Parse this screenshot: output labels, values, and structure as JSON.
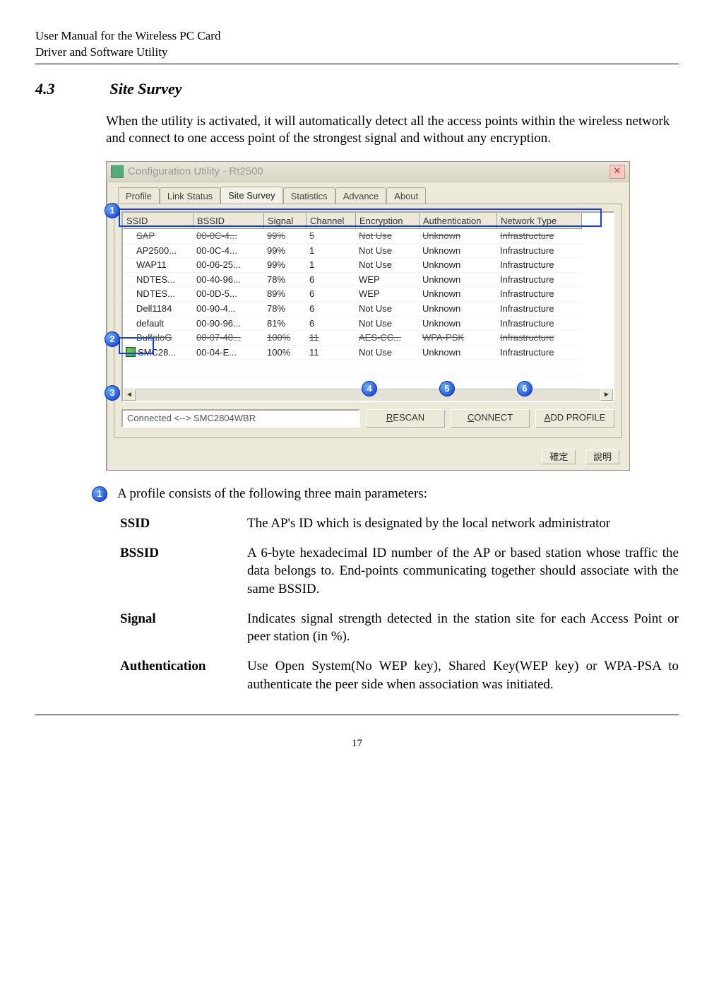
{
  "header": {
    "line1": "User Manual for the Wireless PC Card",
    "line2": "Driver and Software Utility"
  },
  "section": {
    "num": "4.3",
    "title": "Site Survey",
    "intro": "When the utility is activated, it will automatically detect all the access points within the wireless network and connect to one access point of the strongest signal and without any encryption."
  },
  "dialog": {
    "title": "Configuration Utility - Rt2500",
    "tabs": [
      "Profile",
      "Link Status",
      "Site Survey",
      "Statistics",
      "Advance",
      "About"
    ],
    "active_tab": 2,
    "columns": [
      "SSID",
      "BSSID",
      "Signal",
      "Channel",
      "Encryption",
      "Authentication",
      "Network Type"
    ],
    "rows": [
      {
        "ssid": "SAP",
        "bssid": "00-0C-4...",
        "signal": "99%",
        "channel": "5",
        "enc": "Not Use",
        "auth": "Unknown",
        "type": "Infrastructure",
        "strike": true
      },
      {
        "ssid": "AP2500...",
        "bssid": "00-0C-4...",
        "signal": "99%",
        "channel": "1",
        "enc": "Not Use",
        "auth": "Unknown",
        "type": "Infrastructure"
      },
      {
        "ssid": "WAP11",
        "bssid": "00-06-25...",
        "signal": "99%",
        "channel": "1",
        "enc": "Not Use",
        "auth": "Unknown",
        "type": "Infrastructure"
      },
      {
        "ssid": "NDTES...",
        "bssid": "00-40-96...",
        "signal": "78%",
        "channel": "6",
        "enc": "WEP",
        "auth": "Unknown",
        "type": "Infrastructure"
      },
      {
        "ssid": "NDTES...",
        "bssid": "00-0D-5...",
        "signal": "89%",
        "channel": "6",
        "enc": "WEP",
        "auth": "Unknown",
        "type": "Infrastructure"
      },
      {
        "ssid": "Dell1184",
        "bssid": "00-90-4...",
        "signal": "78%",
        "channel": "6",
        "enc": "Not Use",
        "auth": "Unknown",
        "type": "Infrastructure"
      },
      {
        "ssid": "default",
        "bssid": "00-90-96...",
        "signal": "81%",
        "channel": "6",
        "enc": "Not Use",
        "auth": "Unknown",
        "type": "Infrastructure"
      },
      {
        "ssid": "BuffaloG",
        "bssid": "00-07-40...",
        "signal": "100%",
        "channel": "11",
        "enc": "AES-CC...",
        "auth": "WPA-PSK",
        "type": "Infrastructure",
        "strike": true
      },
      {
        "ssid": "SMC28...",
        "bssid": "00-04-E...",
        "signal": "100%",
        "channel": "11",
        "enc": "Not Use",
        "auth": "Unknown",
        "type": "Infrastructure",
        "hand": true
      }
    ],
    "status": "Connected <--> SMC2804WBR",
    "buttons": {
      "rescan": "RESCAN",
      "connect": "CONNECT",
      "addprofile": "ADD PROFILE"
    },
    "dlg_ok": "確定",
    "dlg_help": "說明",
    "callouts": {
      "c1": "1",
      "c2": "2",
      "c3": "3",
      "c4": "4",
      "c5": "5",
      "c6": "6"
    }
  },
  "explain": {
    "c1_lead": "A profile consists of the following three main parameters:",
    "defs": [
      {
        "term": "SSID",
        "desc": "The AP's ID which is designated by the local network administrator"
      },
      {
        "term": "BSSID",
        "desc": "A 6-byte hexadecimal ID number of the AP or based station whose traffic the data belongs to.\nEnd-points communicating together should associate with the same BSSID."
      },
      {
        "term": "Signal",
        "desc": "Indicates signal strength detected in the station site for each Access Point or peer station (in %)."
      },
      {
        "term": "Authentication",
        "desc": "Use Open System(No WEP key), Shared Key(WEP key) or WPA-PSA to authenticate the peer side when association was initiated."
      }
    ]
  },
  "footer": {
    "page": "17"
  }
}
